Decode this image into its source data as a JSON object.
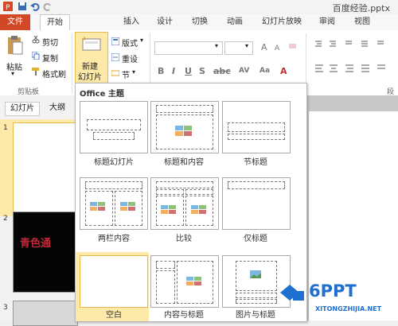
{
  "title_bar": {
    "doc_title": "百度经验.pptx"
  },
  "tabs": [
    "文件",
    "开始",
    "插入",
    "设计",
    "切换",
    "动画",
    "幻灯片放映",
    "审阅",
    "视图"
  ],
  "clipboard": {
    "paste": "粘贴",
    "cut": "剪切",
    "copy": "复制",
    "format_painter": "格式刷",
    "group": "剪贴板"
  },
  "slides_group": {
    "new_slide_line1": "新建",
    "new_slide_line2": "幻灯片",
    "layout": "版式",
    "reset": "重设",
    "section": "节"
  },
  "para_group_label": "段",
  "left_panel": {
    "tab_slides": "幻灯片",
    "tab_outline": "大纲",
    "slide_numbers": [
      "1",
      "2",
      "3"
    ],
    "slide2_text": "青色通"
  },
  "dropdown": {
    "header": "Office 主题",
    "layouts": [
      {
        "label": "标题幻灯片"
      },
      {
        "label": "标题和内容"
      },
      {
        "label": "节标题"
      },
      {
        "label": "两栏内容"
      },
      {
        "label": "比较"
      },
      {
        "label": "仅标题"
      },
      {
        "label": "空白"
      },
      {
        "label": "内容与标题"
      },
      {
        "label": "图片与标题"
      }
    ]
  },
  "watermark": {
    "brand": "6PPT",
    "url": "XITONGZHIJIA.NET"
  },
  "colors": {
    "accent_file": "#d24726",
    "highlight": "#fde9a8",
    "highlight_border": "#e6b84f"
  }
}
